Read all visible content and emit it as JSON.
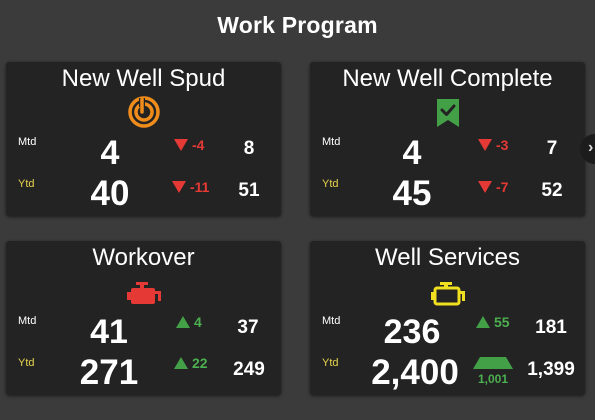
{
  "page": {
    "title": "Work Program"
  },
  "colors": {
    "background": "#3b3b3b",
    "card": "#232323",
    "down": "#e53935",
    "up": "#43a047",
    "ytd_label": "#e8d44d"
  },
  "cards": [
    {
      "title": "New Well Spud",
      "icon": "spud-target-icon",
      "mtd": {
        "label": "Mtd",
        "value": "4",
        "delta": "-4",
        "direction": "down",
        "previous": "8"
      },
      "ytd": {
        "label": "Ytd",
        "value": "40",
        "delta": "-11",
        "direction": "down",
        "previous": "51"
      }
    },
    {
      "title": "New Well Complete",
      "icon": "checkmark-bookmark-icon",
      "mtd": {
        "label": "Mtd",
        "value": "4",
        "delta": "-3",
        "direction": "down",
        "previous": "7"
      },
      "ytd": {
        "label": "Ytd",
        "value": "45",
        "delta": "-7",
        "direction": "down",
        "previous": "52"
      }
    },
    {
      "title": "Workover",
      "icon": "engine-icon",
      "mtd": {
        "label": "Mtd",
        "value": "41",
        "delta": "4",
        "direction": "up",
        "previous": "37"
      },
      "ytd": {
        "label": "Ytd",
        "value": "271",
        "delta": "22",
        "direction": "up",
        "previous": "249"
      }
    },
    {
      "title": "Well Services",
      "icon": "engine-icon",
      "mtd": {
        "label": "Mtd",
        "value": "236",
        "delta": "55",
        "direction": "up",
        "previous": "181"
      },
      "ytd": {
        "label": "Ytd",
        "value": "2,400",
        "delta": "1,001",
        "direction": "up",
        "previous": "1,399"
      }
    }
  ],
  "scroll": {
    "glyph": "›"
  }
}
